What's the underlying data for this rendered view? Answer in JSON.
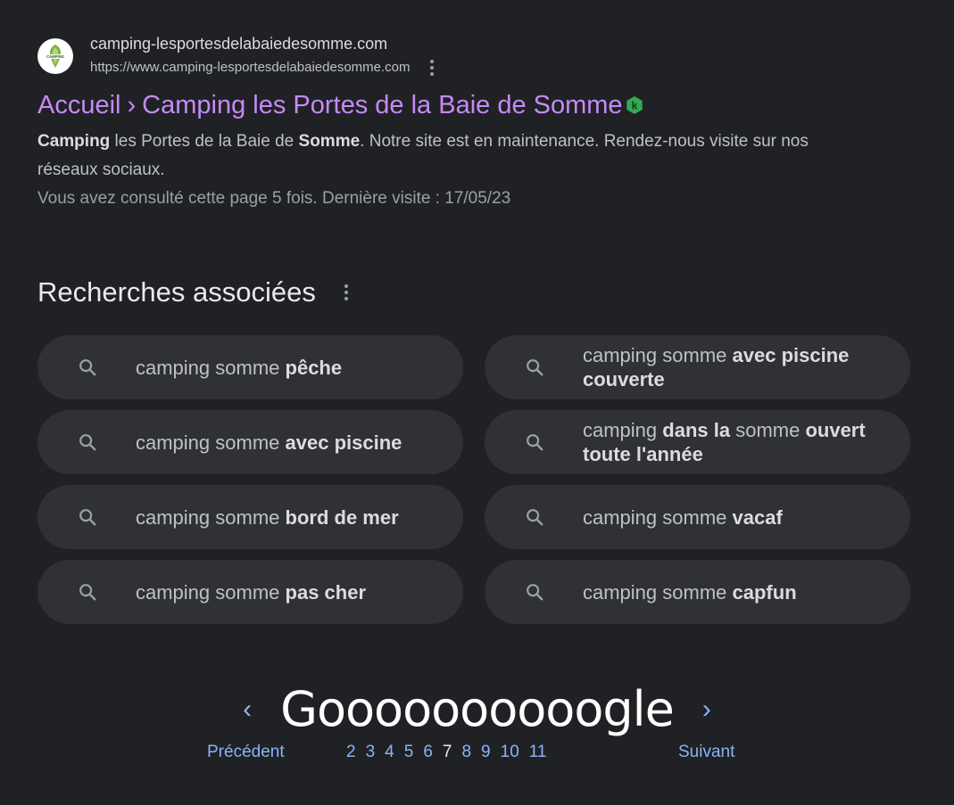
{
  "result": {
    "site_name": "camping-lesportesdelabaiedesomme.com",
    "site_url": "https://www.camping-lesportesdelabaiedesomme.com",
    "favicon_text": "CAMPING",
    "title_breadcrumb": "Accueil",
    "title_separator": "›",
    "title_text": "Camping les Portes de la Baie de Somme",
    "badge_icon": "kagi-k-badge-icon",
    "badge_color": "#34a853",
    "snippet": {
      "bold_1": "Camping",
      "text_1": " les Portes de la Baie de ",
      "bold_2": "Somme",
      "text_2": ". Notre site est en maintenance. Rendez-nous visite sur nos réseaux sociaux."
    },
    "visited_note": "Vous avez consulté cette page 5 fois. Dernière visite : 17/05/23"
  },
  "related": {
    "title": "Recherches associées",
    "chips": [
      {
        "prefix": "camping somme ",
        "bold": "pêche",
        "mid": "",
        "bold2": ""
      },
      {
        "prefix": "camping somme ",
        "bold": "avec piscine couverte",
        "mid": "",
        "bold2": ""
      },
      {
        "prefix": "camping somme ",
        "bold": "avec piscine",
        "mid": "",
        "bold2": ""
      },
      {
        "prefix": "camping ",
        "bold": "dans la",
        "mid": " somme ",
        "bold2": "ouvert toute l'année"
      },
      {
        "prefix": "camping somme ",
        "bold": "bord de mer",
        "mid": "",
        "bold2": ""
      },
      {
        "prefix": "camping somme ",
        "bold": "vacaf",
        "mid": "",
        "bold2": ""
      },
      {
        "prefix": "camping somme ",
        "bold": "pas cher",
        "mid": "",
        "bold2": ""
      },
      {
        "prefix": "camping somme ",
        "bold": "capfun",
        "mid": "",
        "bold2": ""
      }
    ]
  },
  "pagination": {
    "logo_text": "Goooooooooogle",
    "prev_arrow": "‹",
    "next_arrow": "›",
    "prev_label": "Précédent",
    "next_label": "Suivant",
    "pages": [
      "2",
      "3",
      "4",
      "5",
      "6",
      "7",
      "8",
      "9",
      "10",
      "11"
    ],
    "current_page": "7"
  },
  "colors": {
    "background": "#202124",
    "chip_background": "#303134",
    "link_visited": "#c58af9",
    "link": "#8ab4f8"
  }
}
